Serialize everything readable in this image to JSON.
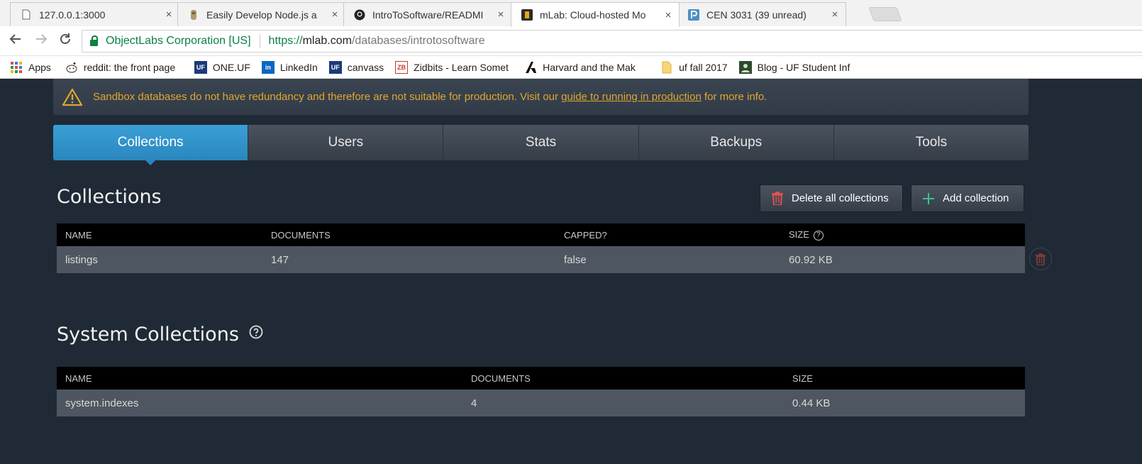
{
  "browser": {
    "tabs": [
      {
        "title": "127.0.0.1:3000",
        "icon": "page-icon"
      },
      {
        "title": "Easily Develop Node.js a",
        "icon": "node-icon"
      },
      {
        "title": "IntroToSoftware/READMI",
        "icon": "github-icon"
      },
      {
        "title": "mLab: Cloud-hosted Mo",
        "icon": "mlab-icon"
      },
      {
        "title": "CEN 3031 (39 unread)",
        "icon": "piazza-icon"
      }
    ],
    "close_glyph": "×",
    "ev_label": "ObjectLabs Corporation [US]",
    "url": {
      "scheme": "https://",
      "host": "mlab.com",
      "path": "/databases/introtosoftware"
    },
    "bookmarks": [
      {
        "label": "Apps",
        "icon": "apps-icon"
      },
      {
        "label": "reddit: the front page",
        "icon": "reddit-icon"
      },
      {
        "label": "ONE.UF",
        "icon": "oneuf-icon"
      },
      {
        "label": "LinkedIn",
        "icon": "linkedin-icon"
      },
      {
        "label": "canvass",
        "icon": "uf-icon"
      },
      {
        "label": "Zidbits - Learn Somet",
        "icon": "zidbits-icon"
      },
      {
        "label": "Harvard and the Mak",
        "icon": "harvard-icon"
      },
      {
        "label": "uf fall 2017",
        "icon": "folder-icon"
      },
      {
        "label": "Blog - UF Student Inf",
        "icon": "blog-icon"
      }
    ]
  },
  "warning": {
    "text_before": "Sandbox databases do not have redundancy and therefore are not suitable for production. Visit our ",
    "link": "guide to running in production",
    "text_after": " for more info."
  },
  "tabs": [
    "Collections",
    "Users",
    "Stats",
    "Backups",
    "Tools"
  ],
  "collections": {
    "title": "Collections",
    "delete_all_label": "Delete all collections",
    "add_label": "Add collection",
    "headers": [
      "NAME",
      "DOCUMENTS",
      "CAPPED?",
      "SIZE"
    ],
    "help_glyph": "?",
    "rows": [
      {
        "name": "listings",
        "documents": "147",
        "capped": "false",
        "size": "60.92 KB"
      }
    ]
  },
  "system_collections": {
    "title": "System Collections",
    "headers": [
      "NAME",
      "DOCUMENTS",
      "SIZE"
    ],
    "rows": [
      {
        "name": "system.indexes",
        "documents": "4",
        "size": "0.44 KB"
      }
    ]
  },
  "colors": {
    "accent": "#2a86be",
    "warning": "#e0a62f",
    "danger": "#d9534f",
    "add": "#3cc28a"
  }
}
